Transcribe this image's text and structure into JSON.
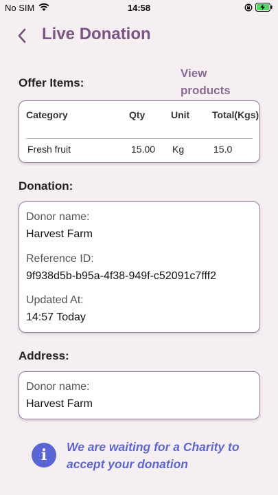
{
  "status_bar": {
    "carrier": "No SIM",
    "time": "14:58"
  },
  "header": {
    "title": "Live Donation"
  },
  "offer_items": {
    "title": "Offer Items:",
    "view_products": "View products",
    "columns": [
      "Category",
      "Qty",
      "Unit",
      "Total(Kgs)"
    ],
    "rows": [
      {
        "category": "Fresh fruit",
        "qty": "15.00",
        "unit": "Kg",
        "total": "15.0"
      }
    ]
  },
  "donation": {
    "title": "Donation:",
    "donor_name_label": "Donor name:",
    "donor_name": "Harvest Farm",
    "reference_label": "Reference ID:",
    "reference_id": "9f938d5b-b95a-4f38-949f-c52091c7fff2",
    "updated_label": "Updated At:",
    "updated_at": "14:57 Today"
  },
  "address": {
    "title": "Address:",
    "donor_name_label": "Donor name:",
    "donor_name": "Harvest Farm"
  },
  "info": {
    "message": "We are waiting for a Charity to accept your donation"
  },
  "colors": {
    "accent": "#7a5583",
    "info": "#5b66d6",
    "background": "#f6eff2",
    "card_border": "#9d7aa8"
  }
}
